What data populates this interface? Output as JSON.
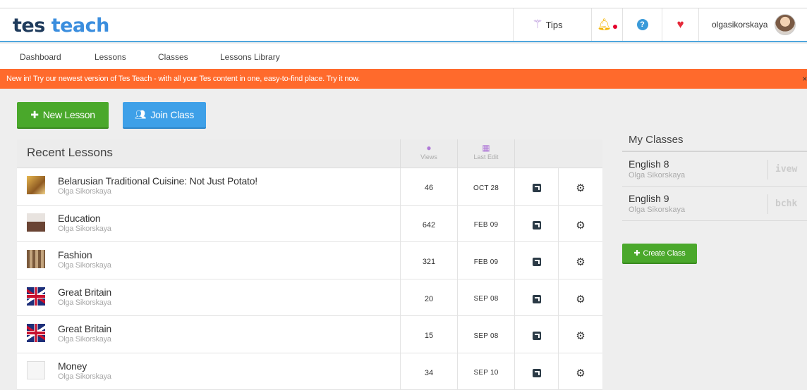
{
  "brand": {
    "part1": "tes",
    "part2": "teach"
  },
  "header": {
    "tips_label": "Tips",
    "username": "olgasikorskaya",
    "icons": [
      "magic-wand-icon",
      "bell-icon",
      "help-icon",
      "heart-icon"
    ]
  },
  "nav": {
    "items": [
      "Dashboard",
      "Lessons",
      "Classes",
      "Lessons Library"
    ]
  },
  "banner": {
    "text": "New in! Try our newest version of Tes Teach - with all your Tes content in one, easy-to-find place. Try it now.",
    "close": "×"
  },
  "actions": {
    "new_lesson": "New Lesson",
    "join_class": "Join Class"
  },
  "lessons": {
    "title": "Recent Lessons",
    "col_views": "Views",
    "col_last_edit": "Last Edit",
    "rows": [
      {
        "name": "Belarusian Traditional Cuisine: Not Just Potato!",
        "author": "Olga Sikorskaya",
        "views": "46",
        "date": "OCT 28"
      },
      {
        "name": "Education",
        "author": "Olga Sikorskaya",
        "views": "642",
        "date": "FEB 09"
      },
      {
        "name": "Fashion",
        "author": "Olga Sikorskaya",
        "views": "321",
        "date": "FEB 09"
      },
      {
        "name": "Great Britain",
        "author": "Olga Sikorskaya",
        "views": "20",
        "date": "SEP 08"
      },
      {
        "name": "Great Britain",
        "author": "Olga Sikorskaya",
        "views": "15",
        "date": "SEP 08"
      },
      {
        "name": "Money",
        "author": "Olga Sikorskaya",
        "views": "34",
        "date": "SEP 10"
      }
    ]
  },
  "classes": {
    "title": "My Classes",
    "items": [
      {
        "name": "English 8",
        "author": "Olga Sikorskaya",
        "code": "ivew"
      },
      {
        "name": "English 9",
        "author": "Olga Sikorskaya",
        "code": "bchk"
      }
    ],
    "create_label": "Create Class"
  },
  "colors": {
    "accent_blue": "#3b8ede",
    "banner_orange": "#ff6a2c",
    "green": "#4aa82b"
  }
}
